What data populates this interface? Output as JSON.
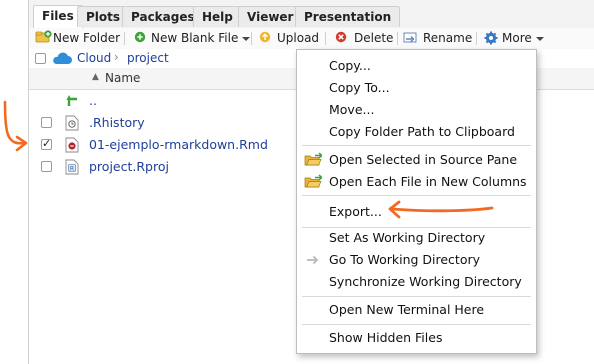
{
  "tabs": [
    {
      "label": "Files",
      "active": true
    },
    {
      "label": "Plots"
    },
    {
      "label": "Packages"
    },
    {
      "label": "Help"
    },
    {
      "label": "Viewer"
    },
    {
      "label": "Presentation"
    }
  ],
  "toolbar": {
    "new_folder": "New Folder",
    "new_blank_file": "New Blank File",
    "upload": "Upload",
    "delete": "Delete",
    "rename": "Rename",
    "more": "More"
  },
  "breadcrumb": {
    "root": "Cloud",
    "folder": "project"
  },
  "columns": {
    "name": "Name",
    "sort": "ascending"
  },
  "files": [
    {
      "name": "..",
      "checked": false,
      "icon": "up-arrow-icon"
    },
    {
      "name": ".Rhistory",
      "checked": false,
      "icon": "history-icon"
    },
    {
      "name": "01-ejemplo-rmarkdown.Rmd",
      "checked": true,
      "icon": "rmarkdown-file-icon"
    },
    {
      "name": "project.Rproj",
      "checked": false,
      "icon": "rproj-file-icon"
    }
  ],
  "menu": {
    "items": [
      {
        "label": "Copy..."
      },
      {
        "label": "Copy To..."
      },
      {
        "label": "Move..."
      },
      {
        "label": "Copy Folder Path to Clipboard"
      },
      {
        "label": "Open Selected in Source Pane",
        "icon": "open-folder-arrow-icon"
      },
      {
        "label": "Open Each File in New Columns",
        "icon": "open-folder-icon"
      },
      {
        "label": "Export..."
      },
      {
        "label": "Set As Working Directory"
      },
      {
        "label": "Go To Working Directory",
        "icon": "goto-arrow-icon"
      },
      {
        "label": "Synchronize Working Directory"
      },
      {
        "label": "Open New Terminal Here"
      },
      {
        "label": "Show Hidden Files"
      }
    ]
  },
  "colors": {
    "annotation": "#f26a21",
    "link": "#1e3f9a",
    "cloud": "#2f8fd6"
  }
}
